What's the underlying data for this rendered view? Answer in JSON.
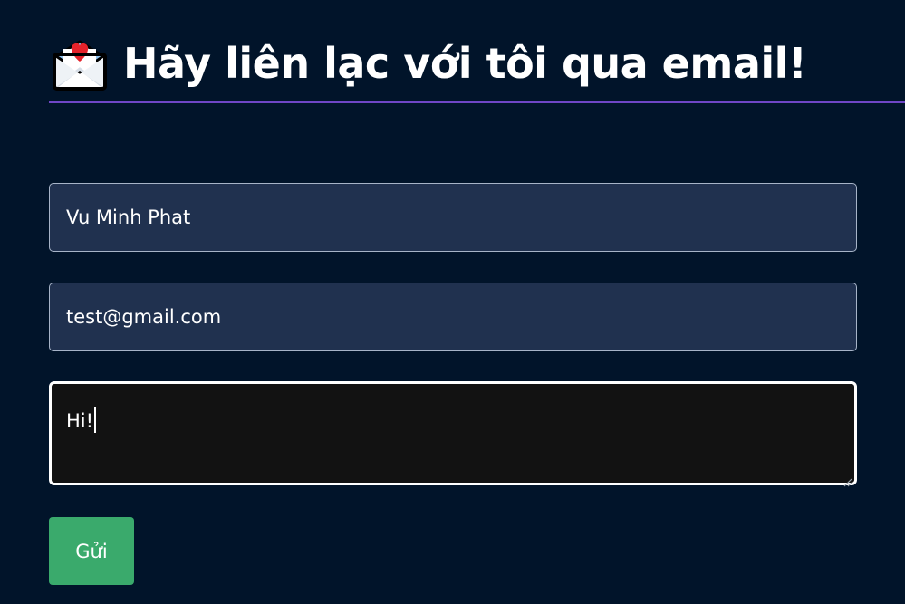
{
  "header": {
    "icon": "love-letter-envelope-icon",
    "title": "Hãy liên lạc với tôi qua email!"
  },
  "form": {
    "name_value": "Vu Minh Phat",
    "email_value": "test@gmail.com",
    "message_value": "Hi!",
    "submit_label": "Gửi"
  },
  "colors": {
    "background": "#01142a",
    "divider": "#6f46c6",
    "input_background": "#20314f",
    "textarea_background": "#121212",
    "button": "#3aaa6c"
  }
}
